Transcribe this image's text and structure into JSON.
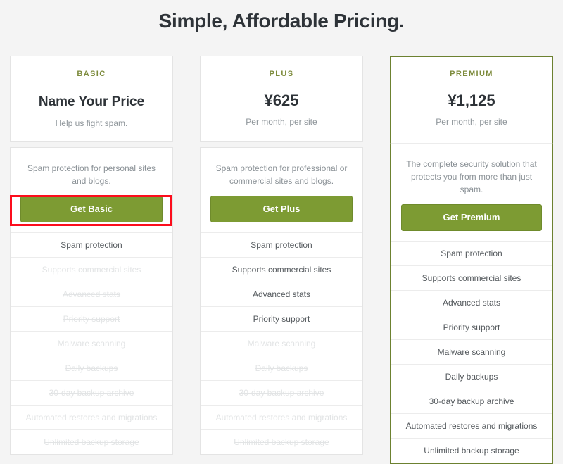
{
  "page": {
    "title": "Simple, Affordable Pricing.",
    "background_color": "#f4f4f4",
    "accent_color": "#7d9b33",
    "featured_border_color": "#6c8130",
    "plan_name_color": "#7d8b3c",
    "annotation_color": "#fc0d1c"
  },
  "annotation": {
    "name": "get-basic-button-highlight",
    "target": "Get Basic"
  },
  "plans": [
    {
      "name": "BASIC",
      "price": "Name Your Price",
      "price_is_text": true,
      "period": "Help us fight spam.",
      "description": "Spam protection for personal sites and blogs.",
      "cta_label": "Get Basic",
      "featured": false,
      "features": [
        {
          "label": "Spam protection",
          "included": true
        },
        {
          "label": "Supports commercial sites",
          "included": false
        },
        {
          "label": "Advanced stats",
          "included": false
        },
        {
          "label": "Priority support",
          "included": false
        },
        {
          "label": "Malware scanning",
          "included": false
        },
        {
          "label": "Daily backups",
          "included": false
        },
        {
          "label": "30-day backup archive",
          "included": false
        },
        {
          "label": "Automated restores and migrations",
          "included": false
        },
        {
          "label": "Unlimited backup storage",
          "included": false
        }
      ]
    },
    {
      "name": "PLUS",
      "price": "¥625",
      "price_is_text": false,
      "period": "Per month, per site",
      "description": "Spam protection for professional or commercial sites and blogs.",
      "cta_label": "Get Plus",
      "featured": false,
      "features": [
        {
          "label": "Spam protection",
          "included": true
        },
        {
          "label": "Supports commercial sites",
          "included": true
        },
        {
          "label": "Advanced stats",
          "included": true
        },
        {
          "label": "Priority support",
          "included": true
        },
        {
          "label": "Malware scanning",
          "included": false
        },
        {
          "label": "Daily backups",
          "included": false
        },
        {
          "label": "30-day backup archive",
          "included": false
        },
        {
          "label": "Automated restores and migrations",
          "included": false
        },
        {
          "label": "Unlimited backup storage",
          "included": false
        }
      ]
    },
    {
      "name": "PREMIUM",
      "price": "¥1,125",
      "price_is_text": false,
      "period": "Per month, per site",
      "description": "The complete security solution that protects you from more than just spam.",
      "cta_label": "Get Premium",
      "featured": true,
      "features": [
        {
          "label": "Spam protection",
          "included": true
        },
        {
          "label": "Supports commercial sites",
          "included": true
        },
        {
          "label": "Advanced stats",
          "included": true
        },
        {
          "label": "Priority support",
          "included": true
        },
        {
          "label": "Malware scanning",
          "included": true
        },
        {
          "label": "Daily backups",
          "included": true
        },
        {
          "label": "30-day backup archive",
          "included": true
        },
        {
          "label": "Automated restores and migrations",
          "included": true
        },
        {
          "label": "Unlimited backup storage",
          "included": true
        }
      ]
    }
  ]
}
